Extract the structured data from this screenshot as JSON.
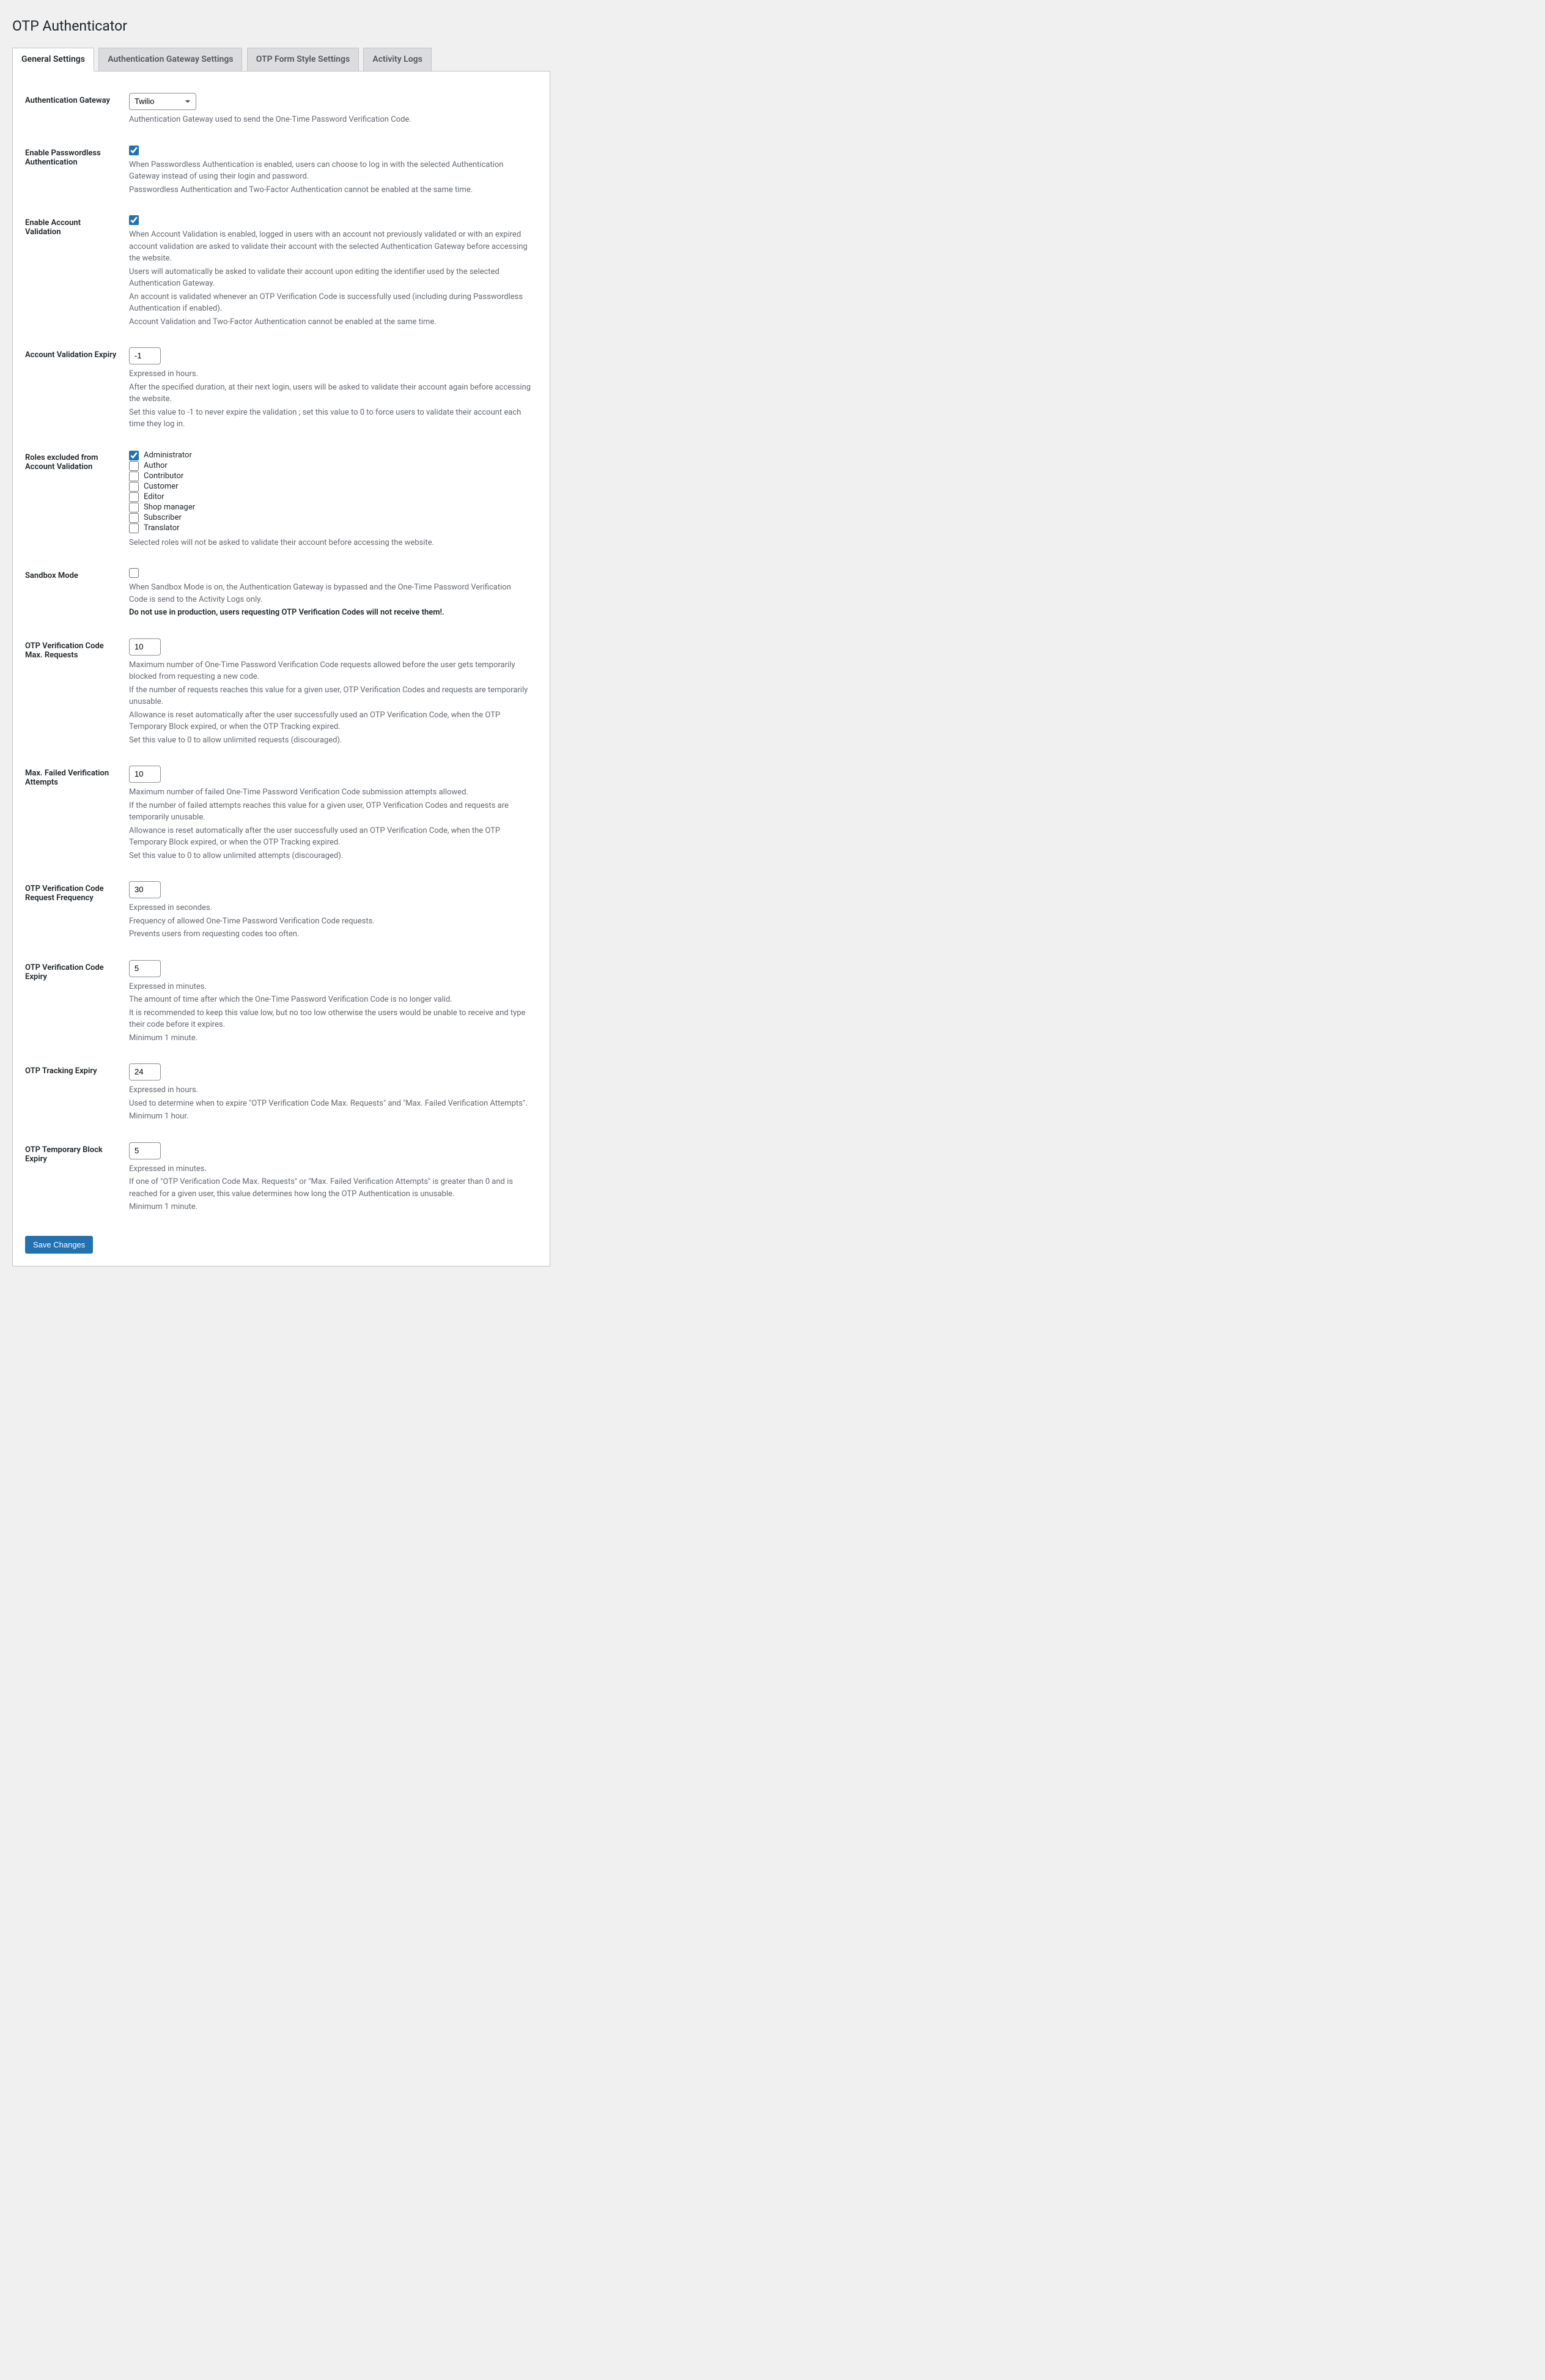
{
  "page": {
    "title": "OTP Authenticator"
  },
  "tabs": [
    {
      "label": "General Settings",
      "active": true
    },
    {
      "label": "Authentication Gateway Settings",
      "active": false
    },
    {
      "label": "OTP Form Style Settings",
      "active": false
    },
    {
      "label": "Activity Logs",
      "active": false
    }
  ],
  "fields": {
    "gateway": {
      "label": "Authentication Gateway",
      "value": "Twilio",
      "desc": "Authentication Gateway used to send the One-Time Password Verification Code."
    },
    "passwordless": {
      "label": "Enable Passwordless Authentication",
      "checked": true,
      "desc1": "When Passwordless Authentication is enabled, users can choose to log in with the selected Authentication Gateway instead of using their login and password.",
      "desc2": "Passwordless Authentication and Two-Factor Authentication cannot be enabled at the same time."
    },
    "validation": {
      "label": "Enable Account Validation",
      "checked": true,
      "desc1": "When Account Validation is enabled, logged in users with an account not previously validated or with an expired account validation are asked to validate their account with the selected Authentication Gateway before accessing the website.",
      "desc2": "Users will automatically be asked to validate their account upon editing the identifier used by the selected Authentication Gateway.",
      "desc3": "An account is validated whenever an OTP Verification Code is successfully used (including during Passwordless Authentication if enabled).",
      "desc4": "Account Validation and Two-Factor Authentication cannot be enabled at the same time."
    },
    "validation_expiry": {
      "label": "Account Validation Expiry",
      "value": "-1",
      "desc1": "Expressed in hours.",
      "desc2": "After the specified duration, at their next login, users will be asked to validate their account again before accessing the website.",
      "desc3": "Set this value to -1 to never expire the validation ; set this value to 0 to force users to validate their account each time they log in."
    },
    "roles": {
      "label": "Roles excluded from Account Validation",
      "options": [
        {
          "label": "Administrator",
          "checked": true
        },
        {
          "label": "Author",
          "checked": false
        },
        {
          "label": "Contributor",
          "checked": false
        },
        {
          "label": "Customer",
          "checked": false
        },
        {
          "label": "Editor",
          "checked": false
        },
        {
          "label": "Shop manager",
          "checked": false
        },
        {
          "label": "Subscriber",
          "checked": false
        },
        {
          "label": "Translator",
          "checked": false
        }
      ],
      "desc": "Selected roles will not be asked to validate their account before accessing the website."
    },
    "sandbox": {
      "label": "Sandbox Mode",
      "checked": false,
      "desc1": "When Sandbox Mode is on, the Authentication Gateway is bypassed and the One-Time Password Verification Code is send to the Activity Logs only.",
      "desc2": "Do not use in production, users requesting OTP Verification Codes will not receive them!."
    },
    "max_requests": {
      "label": "OTP Verification Code Max. Requests",
      "value": "10",
      "desc1": "Maximum number of One-Time Password Verification Code requests allowed before the user gets temporarily blocked from requesting a new code.",
      "desc2": "If the number of requests reaches this value for a given user, OTP Verification Codes and requests are temporarily unusable.",
      "desc3": "Allowance is reset automatically after the user successfully used an OTP Verification Code, when the OTP Temporary Block expired, or when the OTP Tracking expired.",
      "desc4": "Set this value to 0 to allow unlimited requests (discouraged)."
    },
    "max_failed": {
      "label": "Max. Failed Verification Attempts",
      "value": "10",
      "desc1": "Maximum number of failed One-Time Password Verification Code submission attempts allowed.",
      "desc2": "If the number of failed attempts reaches this value for a given user, OTP Verification Codes and requests are temporarily unusable.",
      "desc3": "Allowance is reset automatically after the user successfully used an OTP Verification Code, when the OTP Temporary Block expired, or when the OTP Tracking expired.",
      "desc4": "Set this value to 0 to allow unlimited attempts (discouraged)."
    },
    "request_freq": {
      "label": "OTP Verification Code Request Frequency",
      "value": "30",
      "desc1": "Expressed in secondes.",
      "desc2": "Frequency of allowed One-Time Password Verification Code requests.",
      "desc3": "Prevents users from requesting codes too often."
    },
    "code_expiry": {
      "label": "OTP Verification Code Expiry",
      "value": "5",
      "desc1": "Expressed in minutes.",
      "desc2": "The amount of time after which the One-Time Password Verification Code is no longer valid.",
      "desc3": "It is recommended to keep this value low, but no too low otherwise the users would be unable to receive and type their code before it expires.",
      "desc4": "Minimum 1 minute."
    },
    "tracking_expiry": {
      "label": "OTP Tracking Expiry",
      "value": "24",
      "desc1": "Expressed in hours.",
      "desc2": "Used to determine when to expire \"OTP Verification Code Max. Requests\" and \"Max. Failed Verification Attempts\".",
      "desc3": "Minimum 1 hour."
    },
    "block_expiry": {
      "label": "OTP Temporary Block Expiry",
      "value": "5",
      "desc1": "Expressed in minutes.",
      "desc2": "If one of \"OTP Verification Code Max. Requests\" or \"Max. Failed Verification Attempts\" is greater than 0 and is reached for a given user, this value determines how long the OTP Authentication is unusable.",
      "desc3": "Minimum 1 minute."
    }
  },
  "buttons": {
    "save": "Save Changes"
  }
}
